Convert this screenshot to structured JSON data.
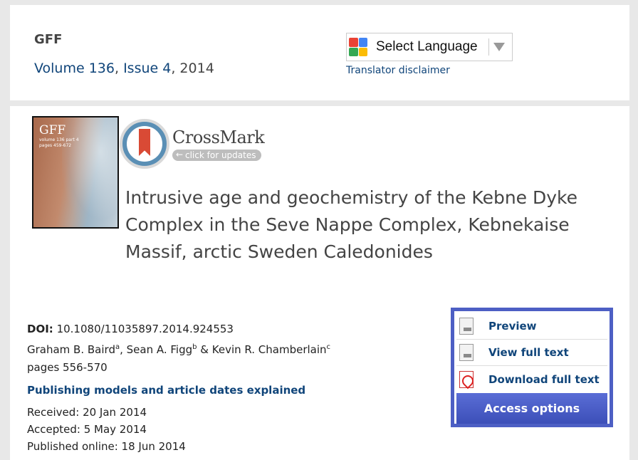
{
  "header": {
    "journal": "GFF",
    "volume_link": "Volume 136",
    "sep1": ", ",
    "issue_link": "Issue 4",
    "year": ", 2014"
  },
  "translate": {
    "label": "Select Language",
    "disclaimer": "Translator disclaimer",
    "colors": [
      "#ea4335",
      "#4285f4",
      "#34a853",
      "#fbbc05"
    ]
  },
  "cover": {
    "title": "GFF",
    "subtitle_1": "volume 136 part 4",
    "subtitle_2": "pages 459-672"
  },
  "crossmark": {
    "title": "CrossMark",
    "pill": "click for updates"
  },
  "article": {
    "title": "Intrusive age and geochemistry of the Kebne Dyke Complex in the Seve Nappe Complex, Kebnekaise Massif, arctic Sweden Caledonides",
    "doi_label": "DOI:",
    "doi": "10.1080/11035897.2014.924553",
    "author1": "Graham B. Baird",
    "aff1": "a",
    "author2": ", Sean A. Figg",
    "aff2": "b",
    "author3": " & Kevin R. Chamberlain",
    "aff3": "c",
    "pages": "pages 556-570",
    "pub_models": "Publishing models and article dates explained",
    "received": "Received: 20 Jan 2014",
    "accepted": "Accepted: 5 May 2014",
    "published": "Published online: 18 Jun 2014"
  },
  "access": {
    "preview": "Preview",
    "view_full": "View full text",
    "download": "Download full text",
    "options": "Access options"
  }
}
